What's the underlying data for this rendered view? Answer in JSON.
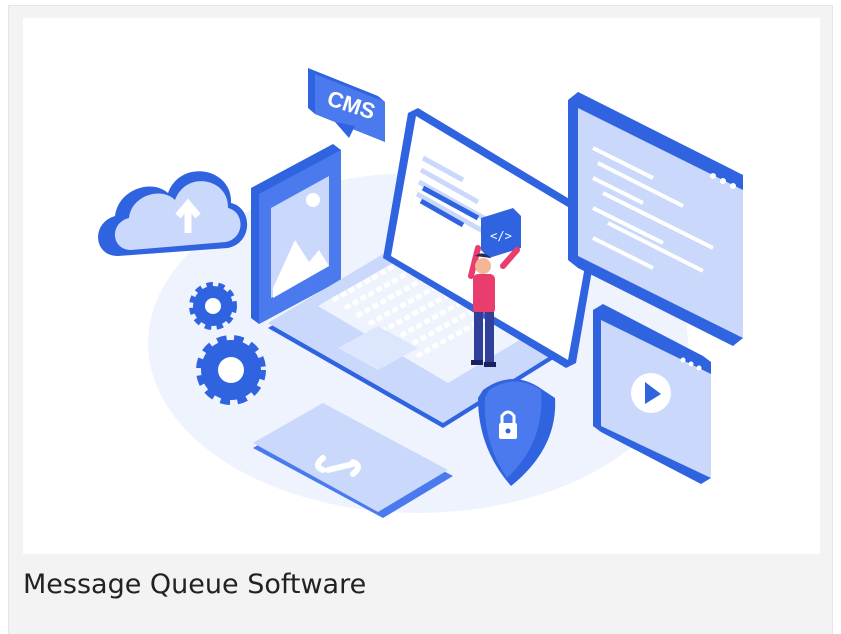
{
  "card": {
    "caption": "Message Queue Software"
  },
  "illustration": {
    "cms_label": "CMS",
    "code_tag": "</>",
    "icons": [
      "cloud-upload-icon",
      "image-icon",
      "gear-icon",
      "lock-icon",
      "play-icon",
      "code-braces-icon"
    ],
    "colors": {
      "primary": "#2f63e0",
      "light": "#c9d8fb",
      "pale": "#e6eefd",
      "accent": "#e83d6d"
    }
  }
}
